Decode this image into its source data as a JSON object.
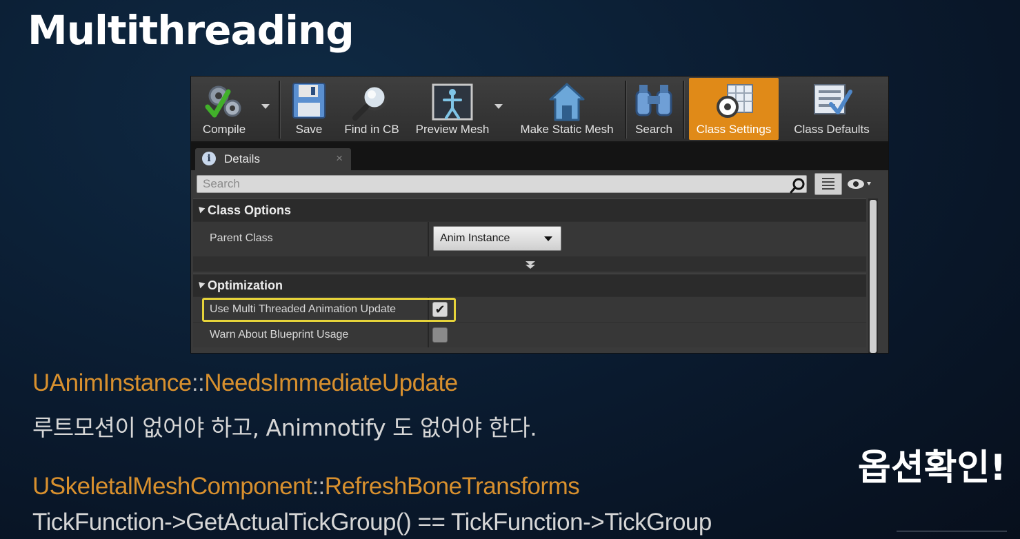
{
  "slide": {
    "title": "Multithreading",
    "side_note": "옵션확인!"
  },
  "toolbar": {
    "buttons": [
      {
        "label": "Compile",
        "icon": "compile-gears-check-icon"
      },
      {
        "label": "Save",
        "icon": "save-floppy-icon"
      },
      {
        "label": "Find in CB",
        "icon": "magnifier-icon"
      },
      {
        "label": "Preview Mesh",
        "icon": "preview-mesh-icon"
      },
      {
        "label": "Make Static Mesh",
        "icon": "make-static-mesh-house-icon"
      },
      {
        "label": "Search",
        "icon": "binoculars-icon"
      },
      {
        "label": "Class Settings",
        "icon": "class-settings-icon",
        "active": true
      },
      {
        "label": "Class Defaults",
        "icon": "class-defaults-icon"
      }
    ]
  },
  "details_tab": {
    "label": "Details",
    "close": "×"
  },
  "search": {
    "placeholder": "Search"
  },
  "sections": {
    "class_options": {
      "title": "Class Options",
      "parent_class_label": "Parent Class",
      "parent_class_value": "Anim Instance"
    },
    "optimization": {
      "title": "Optimization",
      "rows": [
        {
          "label": "Use Multi Threaded Animation Update",
          "checked": true
        },
        {
          "label": "Warn About Blueprint Usage",
          "checked": false
        }
      ]
    }
  },
  "notes": {
    "line1_class": "UAnimInstance",
    "line1_sep": "::",
    "line1_fn": "NeedsImmediateUpdate",
    "line2": "루트모션이 없어야 하고, Animnotify 도 없어야 한다.",
    "line3_class": "USkeletalMeshComponent",
    "line3_sep": "::",
    "line3_fn": "RefreshBoneTransforms",
    "line4": "TickFunction->GetActualTickGroup() == TickFunction->TickGroup"
  },
  "colors": {
    "accent_orange": "#e08a18",
    "highlight_yellow": "#e6d33a",
    "code_orange": "#d8902e"
  }
}
